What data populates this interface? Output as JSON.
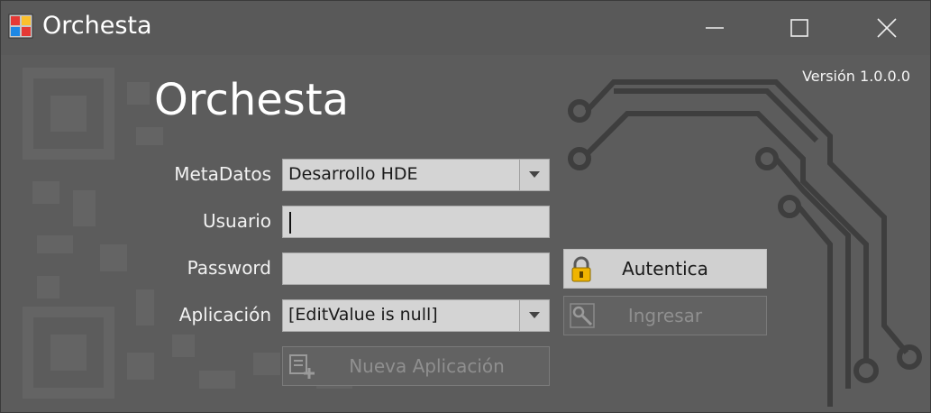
{
  "window": {
    "title": "Orchesta",
    "icon": "app-window-icon",
    "controls": {
      "minimize": "minimize-icon",
      "maximize": "maximize-icon",
      "close": "close-icon"
    }
  },
  "version_text": "Versión 1.0.0.0",
  "heading": "Orchesta",
  "form": {
    "metadatos": {
      "label": "MetaDatos",
      "value": "Desarrollo HDE"
    },
    "usuario": {
      "label": "Usuario",
      "value": ""
    },
    "password": {
      "label": "Password",
      "value": ""
    },
    "aplicacion": {
      "label": "Aplicación",
      "value": "[EditValue is null]"
    }
  },
  "buttons": {
    "autentica": {
      "label": "Autentica",
      "icon": "lock-icon",
      "enabled": true
    },
    "ingresar": {
      "label": "Ingresar",
      "icon": "tools-icon",
      "enabled": false
    },
    "nueva_aplicacion": {
      "label": "Nueva Aplicación",
      "icon": "add-app-icon",
      "enabled": false
    }
  },
  "colors": {
    "background": "#595959",
    "field": "#d4d4d4",
    "text": "#ffffff"
  }
}
